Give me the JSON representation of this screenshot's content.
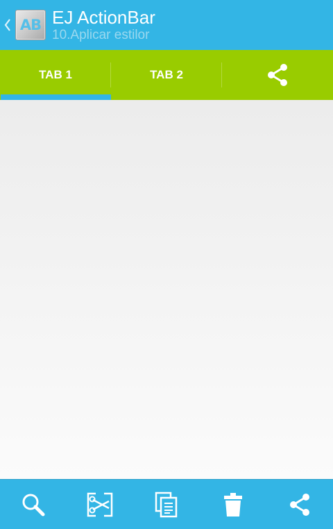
{
  "actionbar": {
    "logo_text": "AB",
    "title": "EJ ActionBar",
    "subtitle": "10.Aplicar estilor",
    "up_icon": "chevron-left-icon",
    "background": "#33b5e5"
  },
  "tabs": {
    "background": "#99cc00",
    "indicator_color": "#33b5e5",
    "items": [
      {
        "label": "TAB 1",
        "selected": true
      },
      {
        "label": "TAB 2",
        "selected": false
      },
      {
        "icon": "share-icon"
      }
    ]
  },
  "bottom_actions": [
    {
      "icon": "search-icon"
    },
    {
      "icon": "cut-icon"
    },
    {
      "icon": "copy-icon"
    },
    {
      "icon": "trash-icon"
    },
    {
      "icon": "share-icon"
    }
  ]
}
